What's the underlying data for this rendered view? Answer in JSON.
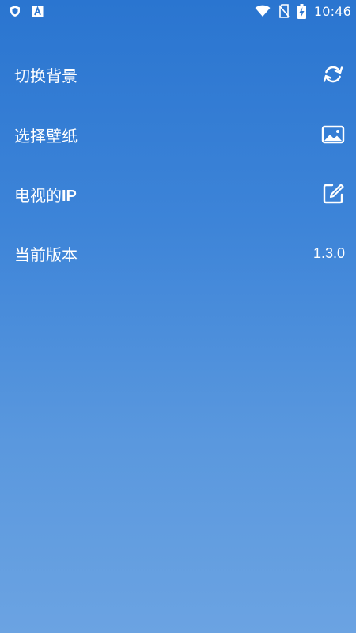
{
  "status_bar": {
    "time": "10:46",
    "left_icons": [
      "shield-icon",
      "app-a-icon"
    ],
    "right_icons": [
      "wifi-icon",
      "no-sim-icon",
      "battery-charging-icon"
    ]
  },
  "menu": {
    "items": [
      {
        "label": "切换背景",
        "icon": "refresh-icon"
      },
      {
        "label": "选择壁纸",
        "icon": "image-icon"
      },
      {
        "label_cjk": "电视的",
        "label_latin": "IP",
        "icon": "edit-icon"
      },
      {
        "label": "当前版本",
        "value": "1.3.0"
      }
    ]
  },
  "colors": {
    "background_top": "#2a75d0",
    "background_bottom": "#6ba3e2",
    "text": "#ffffff"
  }
}
